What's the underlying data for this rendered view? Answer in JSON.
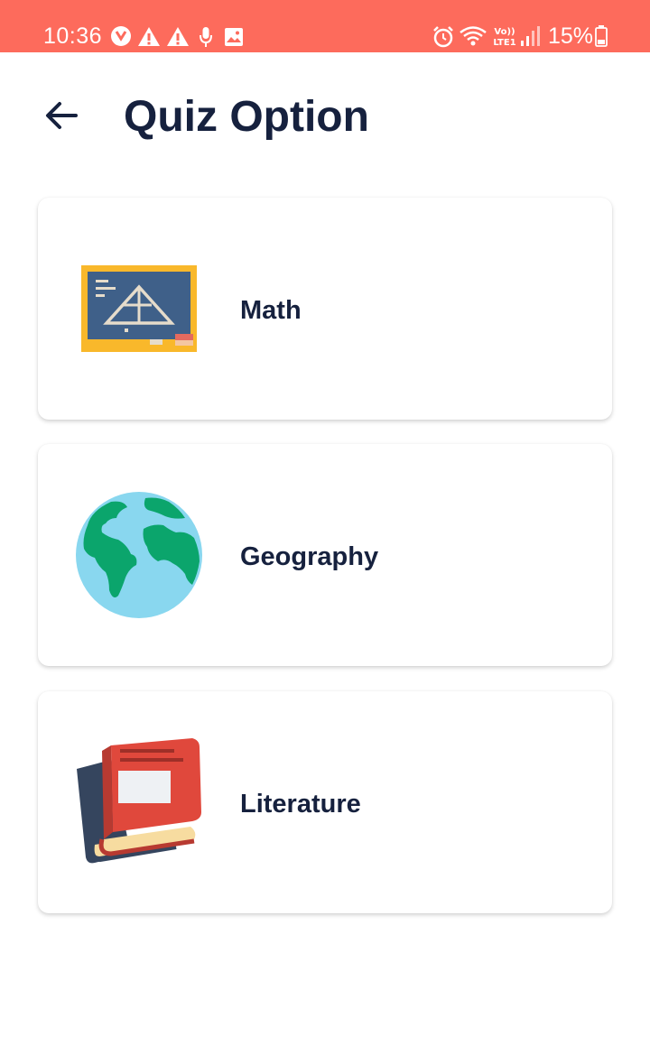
{
  "status_bar": {
    "time": "10:36",
    "battery": "15%",
    "icons": [
      "app-icon",
      "warning-icon",
      "warning-icon",
      "microphone-icon",
      "image-icon",
      "alarm-icon",
      "wifi-icon",
      "volte-lte-icon",
      "signal-icon",
      "battery-icon"
    ],
    "background_color": "#fd6b5c"
  },
  "header": {
    "title": "Quiz Option",
    "back_icon": "arrow-left-icon"
  },
  "options": [
    {
      "label": "Math",
      "icon": "chalkboard-icon"
    },
    {
      "label": "Geography",
      "icon": "globe-icon"
    },
    {
      "label": "Literature",
      "icon": "books-icon"
    }
  ],
  "colors": {
    "title": "#16213e",
    "accent": "#fd6b5c"
  }
}
